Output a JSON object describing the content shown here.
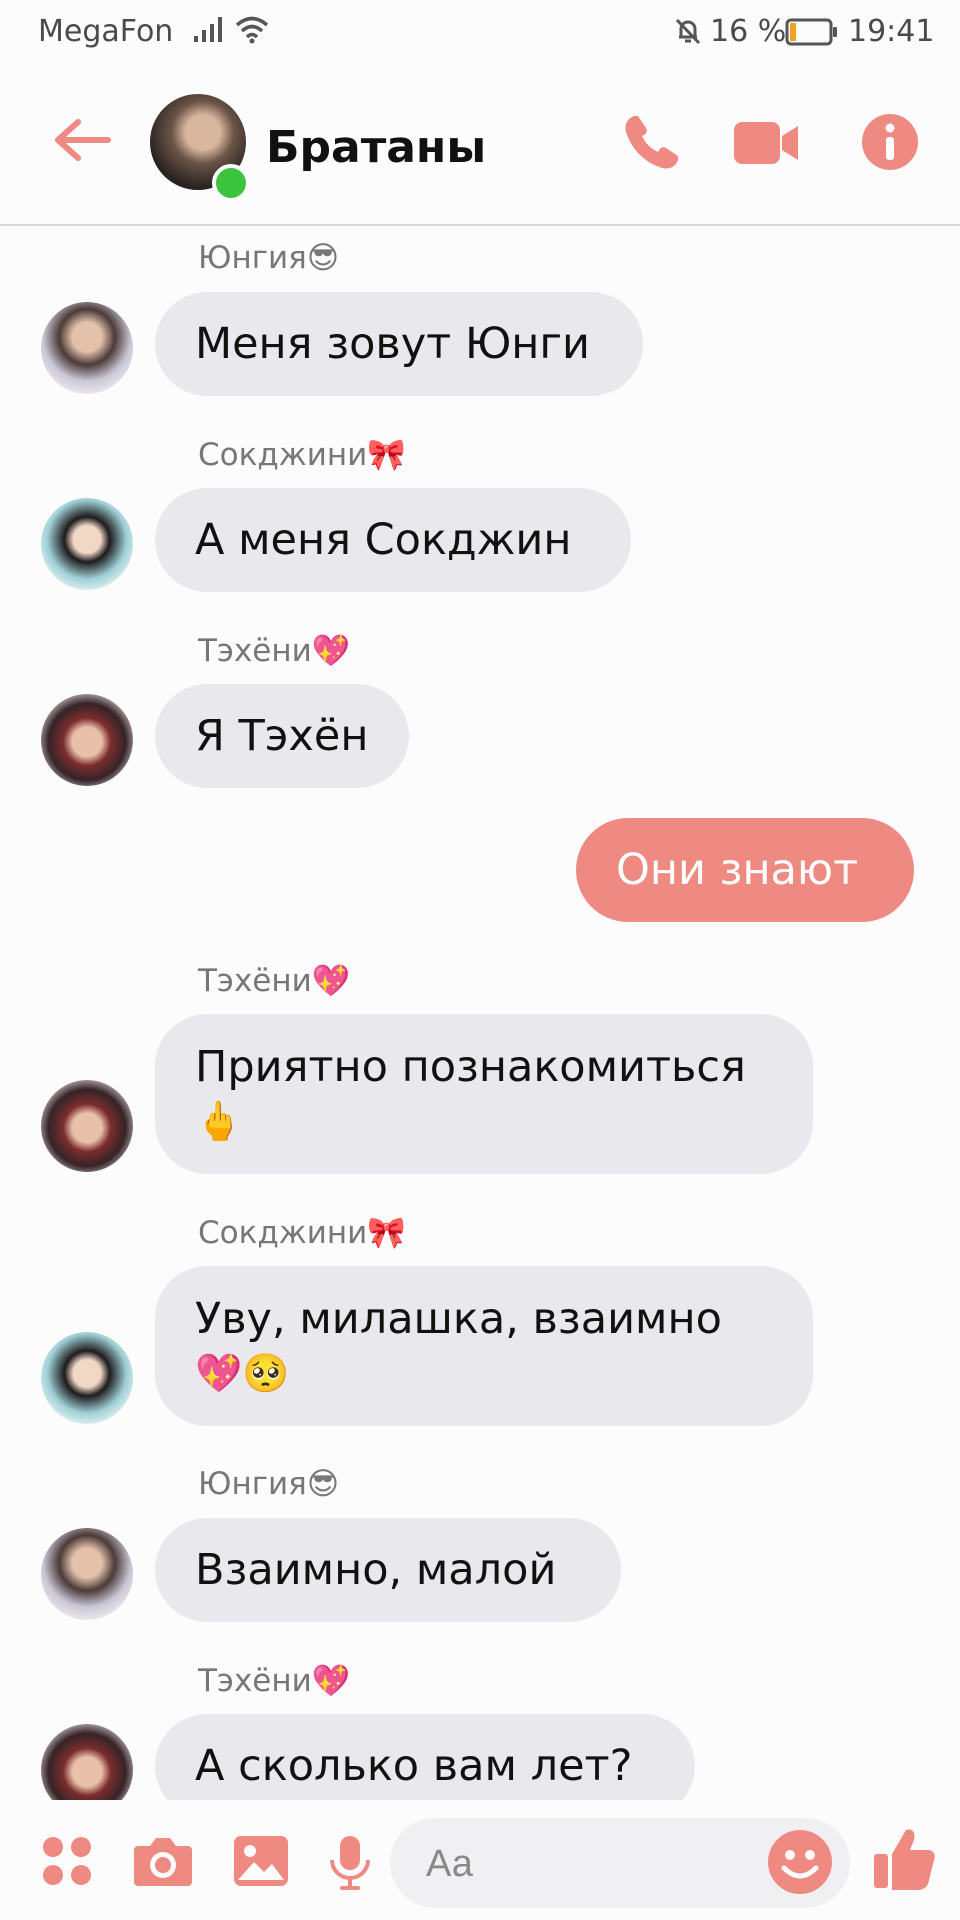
{
  "status_bar": {
    "carrier": "MegaFon",
    "battery": "16 %",
    "battery_level": 0.16,
    "time": "19:41",
    "icons": [
      "signal-icon",
      "wifi-icon",
      "bell-off-icon",
      "battery-icon"
    ]
  },
  "header": {
    "title": "Братаны",
    "online": true,
    "actions": [
      "back-arrow-icon",
      "phone-icon",
      "video-icon",
      "info-icon"
    ]
  },
  "messages": [
    {
      "sender": "Юнгия😎",
      "text": "Меня зовут Юнги",
      "avatar": "yoongi"
    },
    {
      "sender": "Сокджини🎀",
      "text": "А меня Сокджин",
      "avatar": "seokjin"
    },
    {
      "sender": "Тэхёни💖",
      "text": "Я Тэхён",
      "avatar": "taehyung"
    },
    {
      "sender": "",
      "text": "Они знают",
      "outgoing": true
    },
    {
      "sender": "Тэхёни💖",
      "text": "Приятно познакомиться",
      "text2": "🖕",
      "avatar": "taehyung"
    },
    {
      "sender": "Сокджини🎀",
      "text": "Уву, милашка, взаимно",
      "text2": "💖🥺",
      "avatar": "seokjin"
    },
    {
      "sender": "Юнгия😎",
      "text": "Взаимно, малой",
      "avatar": "yoongi"
    },
    {
      "sender": "Тэхёни💖",
      "text": "А сколько вам лет?",
      "avatar": "taehyung"
    }
  ],
  "composer": {
    "placeholder": "Аа",
    "icons": [
      "apps-icon",
      "camera-icon",
      "gallery-icon",
      "mic-icon",
      "emoji-icon",
      "like-icon"
    ]
  },
  "colors": {
    "accent": "#ef8a82",
    "incoming_bubble": "#e9e8ec",
    "online": "#3cc43e"
  }
}
